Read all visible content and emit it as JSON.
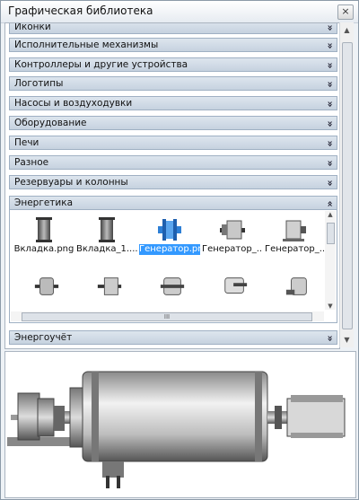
{
  "window": {
    "title": "Графическая библиотека",
    "close_label": "×"
  },
  "categories_top": [
    "Иконки",
    "Исполнительные механизмы",
    "Контроллеры и другие устройства",
    "Логотипы",
    "Насосы и воздуходувки",
    "Оборудование",
    "Печи",
    "Разное",
    "Резервуары и колонны"
  ],
  "expanded_group": {
    "title": "Энергетика",
    "items": [
      {
        "label": "Вкладка.png",
        "icon": "insert-icon"
      },
      {
        "label": "Вкладка_1....",
        "icon": "insert-icon"
      },
      {
        "label": "Генератор.png",
        "icon": "generator-icon",
        "selected": true
      },
      {
        "label": "Генератор_...",
        "icon": "generator-icon"
      },
      {
        "label": "Генератор_...",
        "icon": "generator-icon"
      }
    ],
    "hscroll_grip": "III"
  },
  "categories_bottom": [
    "Энергоучёт"
  ],
  "chevron_down": "»",
  "chevron_up": "«",
  "colors": {
    "selection": "#3399ff",
    "header_bg": "#c6d2df"
  }
}
